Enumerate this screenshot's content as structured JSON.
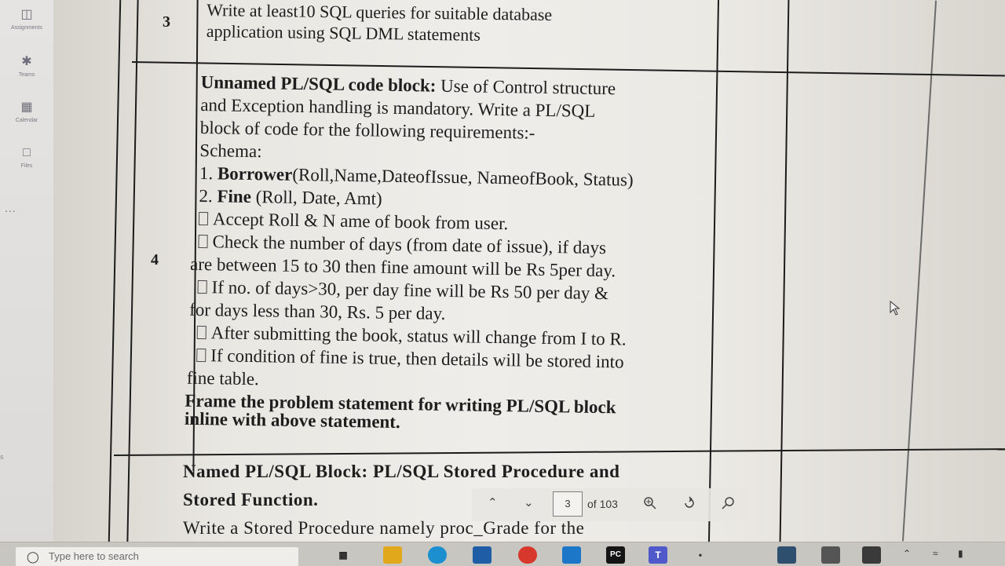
{
  "sidebar": {
    "items": [
      {
        "icon": "assignments-icon",
        "label": "Assignments"
      },
      {
        "icon": "teams-icon",
        "label": "Teams"
      },
      {
        "icon": "calendar-icon",
        "label": "Calendar"
      },
      {
        "icon": "files-icon",
        "label": "Files"
      }
    ],
    "more": "...",
    "fragment": "s"
  },
  "document": {
    "row3": {
      "sr": "3",
      "lines": [
        "Write at least10 SQL queries for suitable database",
        "application using SQL DML statements"
      ]
    },
    "row4": {
      "sr": "4",
      "title_bold": "Unnamed PL/SQL code block:",
      "title_rest": " Use of Control structure",
      "line2": "and Exception handling is mandatory. Write a  PL/SQL",
      "line3": "block of code for the following requirements:-",
      "line4": "Schema:",
      "schema1_num": "1. ",
      "schema1_bold": "Borrower",
      "schema1_rest": "(Roll,Name,DateofIssue, NameofBook, Status)",
      "schema2_num": "2. ",
      "schema2_bold": "Fine",
      "schema2_rest": " (Roll, Date, Amt)",
      "bullet1": "Accept Roll & N  ame of book from user.",
      "bullet2": "Check the number of days (from date of issue), if days",
      "bullet2_cont": "are between 15 to 30 then fine amount will be Rs 5per day.",
      "bullet3": "If no. of days>30, per day fine will be Rs 50 per day &",
      "bullet3_cont": "for days less than 30, Rs. 5 per day.",
      "bullet4": "After submitting the book, status will change from I to R.",
      "bullet5": "If condition of fine is true, then details will be stored into",
      "bullet5_cont": "fine table.",
      "frame1": "Frame the problem statement for writing PL/SQL block",
      "frame2": "inline with above statement."
    },
    "row5": {
      "line1": "Named PL/SQL Block: PL/SQL Stored Procedure and",
      "line2": "Stored Function.",
      "line3": "Write a Stored Procedure namely proc_Grade for the"
    }
  },
  "pdf_toolbar": {
    "prev_icon": "chevron-up-icon",
    "next_icon": "chevron-down-icon",
    "page": "3",
    "of_label": "of 103",
    "zoom_icon": "zoom-icon",
    "rotate_icon": "rotate-icon",
    "search_icon": "search-icon"
  },
  "taskbar": {
    "search_placeholder": "Type here to search",
    "app_pycharm": "PC",
    "app_teams": "T"
  }
}
